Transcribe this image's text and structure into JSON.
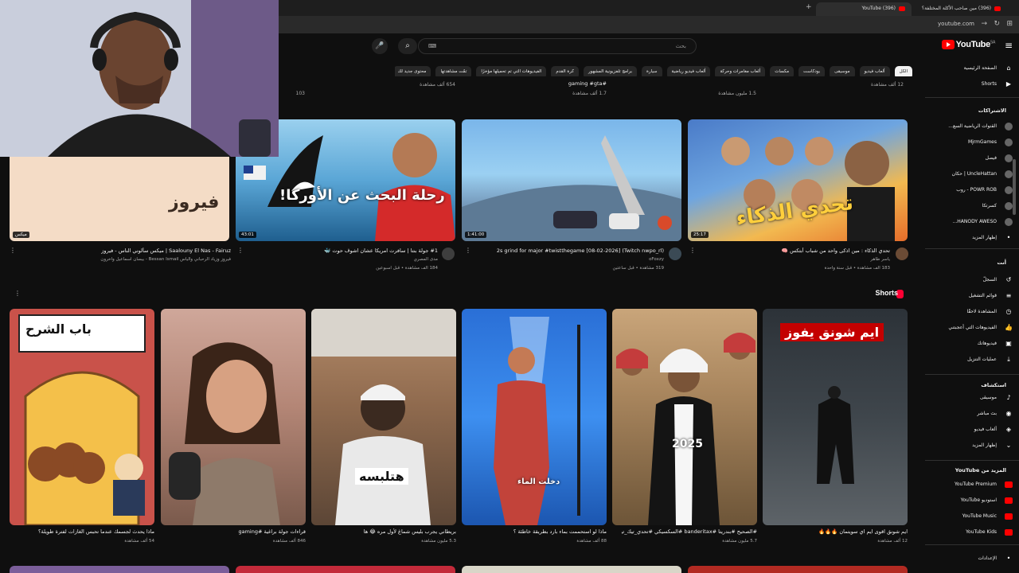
{
  "browser": {
    "tabs": [
      {
        "title": "(396) YouTube",
        "active": true
      },
      {
        "title": "(396) مين صاحب الأكلة المختلفة؟"
      }
    ],
    "address": "youtube.com"
  },
  "header": {
    "search_placeholder": "بحث",
    "logo_text": "YouTube",
    "country": "SA"
  },
  "chips": [
    "الكل",
    "ألعاب فيديو",
    "موسيقى",
    "بودكاست",
    "مكسات",
    "ألعاب مغامرات وحركة",
    "ألعاب فيديو رياضية",
    "سيارة",
    "برامج تلفزيونية المشهور",
    "كرة القدم",
    "الفيديوهات التي تم تحميلها مؤخرًا",
    "تمّت مشاهدتها",
    "محتوى جديد لك"
  ],
  "sidebar": {
    "main": [
      {
        "label": "الصفحة الرئيسية",
        "icon": "home-icon"
      },
      {
        "label": "Shorts",
        "icon": "shorts-icon"
      }
    ],
    "subscriptions_title": "الاشتراكات",
    "subscriptions": [
      {
        "label": "القنوات الرياضية السع..."
      },
      {
        "label": "MjrmGames"
      },
      {
        "label": "فيصل"
      },
      {
        "label": "UncleHattan | حكان"
      },
      {
        "label": "POWR ROB - روب"
      },
      {
        "label": "كسرتكا"
      },
      {
        "label": "HANODY AWESO..."
      },
      {
        "label": "إظهار المزيد"
      }
    ],
    "you_title": "أنت",
    "you": [
      {
        "label": "السجلّ",
        "icon": "history-icon"
      },
      {
        "label": "قوائم التشغيل",
        "icon": "playlist-icon"
      },
      {
        "label": "المشاهدة لاحقًا",
        "icon": "clock-icon"
      },
      {
        "label": "الفيديوهات التي أعجبتني",
        "icon": "thumb-up-icon"
      },
      {
        "label": "فيديوهاتك",
        "icon": "video-icon"
      },
      {
        "label": "عمليات التنزيل",
        "icon": "download-icon"
      }
    ],
    "explore_title": "استكشاف",
    "explore": [
      {
        "label": "موسيقى",
        "icon": "music-icon"
      },
      {
        "label": "بث مباشر",
        "icon": "live-icon"
      },
      {
        "label": "ألعاب فيديو",
        "icon": "gaming-icon"
      },
      {
        "label": "إظهار المزيد",
        "icon": "chevron-down-icon"
      }
    ],
    "more_title": "المزيد من YouTube",
    "more": [
      {
        "label": "YouTube Premium"
      },
      {
        "label": "استوديو YouTube"
      },
      {
        "label": "YouTube Music"
      },
      {
        "label": "YouTube Kids"
      }
    ],
    "settings_label": "الإعدادات"
  },
  "prev_row": [
    {
      "meta": "12 ألف مشاهدة"
    },
    {
      "meta": "1.5 مليون مشاهدة"
    },
    {
      "title": "#gaming #gta",
      "meta": "1.7 ألف مشاهدة"
    },
    {
      "meta": "654 ألف مشاهدة"
    },
    {
      "meta": "103"
    }
  ],
  "videos": [
    {
      "title": "تحدي الذكاء : مين اذكى واحد من شباب أبتكس 🧠",
      "channel": "ياسر طاهر",
      "meta": "183 ألف مشاهدة • قبل سنة واحدة",
      "duration": "25:17",
      "overlay": "تحدي الذكاء"
    },
    {
      "title": "(Twitch nwpo_rl) 2s grind for major #twistthegame [08-02-2026]",
      "channel": "oFoxzy",
      "meta": "319 مشاهدة • قبل ساعتين",
      "duration": "1:41:00"
    },
    {
      "title": "#1 جولة بنتا | سافرت امريكا عشان اشوف حوت 🐳",
      "channel": "مدى المصري",
      "meta": "184 ألف مشاهدة • قبل أسبوعين",
      "duration": "43:01",
      "overlay": "رحلة البحث عن الأوركا!"
    },
    {
      "title": "Saalouny El Nas - Fairuz | ميكس سألوني الناس - فيروز",
      "channel": "فيروز وزياد الرحباني والياس Bessan Ismail - بيسان اسماعيل وآخرون",
      "meta": "",
      "duration": "ميكس",
      "overlay": "فيروز"
    }
  ],
  "shorts_title": "Shorts",
  "shorts": [
    {
      "title": "ايم شونق اقوى ايم اي سويتمان 🔥🔥🔥",
      "meta": "12 ألف مشاهدة",
      "overlay": "ايم شونق يفوز"
    },
    {
      "title": "#الصحيح #بندريتا #banderitax #السكسيكي #تحدي_تيك_توك",
      "meta": "5.7 مليون مشاهدة",
      "overlay": "2025"
    },
    {
      "title": "ماذا لو استحممت بماء بارد بطريقة خاطئة ؟",
      "meta": "88 ألف مشاهدة",
      "overlay": "دخلت الماء"
    },
    {
      "title": "بريطاني يجرب بليس شماغ لأول مره 😂 ها",
      "meta": "5.3 مليون مشاهدة",
      "overlay": "هتلبسه"
    },
    {
      "title": "قراءات جولة براغية #gaming",
      "meta": "846 ألف مشاهدة"
    },
    {
      "title": "ماذا يحدث لجسمك عندما تحبس الغازات لفترة طويلة؟",
      "meta": "54 ألف مشاهدة",
      "overlay": "باب الشرح"
    }
  ]
}
